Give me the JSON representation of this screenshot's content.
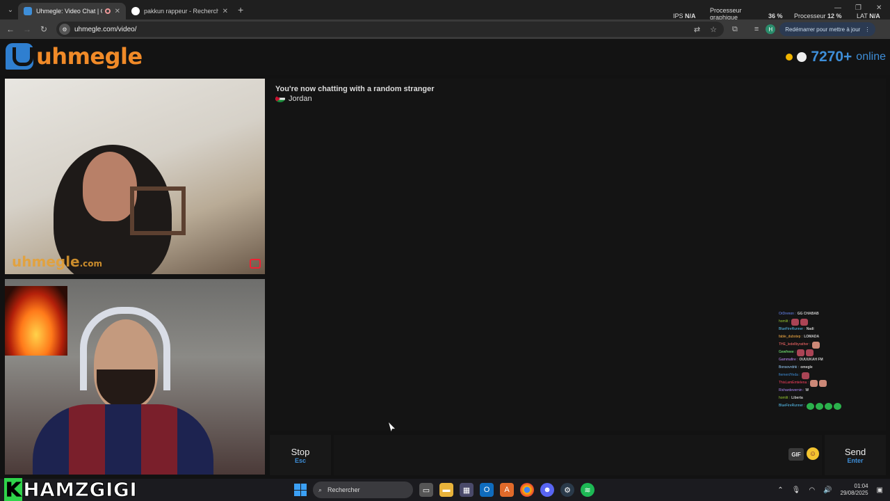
{
  "browser": {
    "tabs": [
      {
        "title": "Uhmegle: Video Chat | Om",
        "active": true,
        "favicon_color": "#3e8ed8"
      },
      {
        "title": "pakkun rappeur - Recherche G",
        "active": false,
        "favicon_color": "#ffffff"
      }
    ],
    "url": "uhmegle.com/video/",
    "update_button": "Redémarrer pour mettre à jour",
    "profile_initial": "H"
  },
  "hud": {
    "ips_label": "IPS",
    "ips_value": "N/A",
    "gpu_label_1": "Processeur",
    "gpu_label_2": "graphique",
    "gpu_value": "36 %",
    "cpu_label": "Processeur",
    "cpu_value": "12 %",
    "lat_label": "LAT",
    "lat_value": "N/A"
  },
  "site": {
    "logo_text": "uhmegle",
    "online_count": "7270+",
    "online_label": "online",
    "accent": "#3e8ed8",
    "brand_orange": "#f08a28"
  },
  "video": {
    "watermark": "uhmegle",
    "watermark_suffix": ".com"
  },
  "chat": {
    "status": "You're now chatting with a random stranger",
    "stranger_name": "Jordan",
    "stranger_flag": "jordan-flag"
  },
  "stream_chat": [
    {
      "user": "OrDrenon",
      "msg": "GG CHABAB",
      "color": "#6b8cff",
      "emotes": 0
    },
    {
      "user": "homlit",
      "msg": "",
      "color": "#9acd32",
      "emotes": 2
    },
    {
      "user": "BlueFireRunner",
      "msg": "Nadi",
      "color": "#5ac8fa",
      "emotes": 0
    },
    {
      "user": "fable_dubstep",
      "msg": "LOMADA",
      "color": "#ffb347",
      "emotes": 0
    },
    {
      "user": "THE_ledellbyrather",
      "msg": "",
      "color": "#ff6a6a",
      "emotes": 1
    },
    {
      "user": "Gewfreee",
      "msg": "",
      "color": "#7fff7f",
      "emotes": 2
    },
    {
      "user": "Gammafire",
      "msg": "OUUUKAH FM",
      "color": "#c38cff",
      "emotes": 0
    },
    {
      "user": "Bonsovrdrki",
      "msg": "omegle",
      "color": "#9ad0ff",
      "emotes": 0
    },
    {
      "user": "fiemerdYeda",
      "msg": "",
      "color": "#3e8ed8",
      "emotes": 1
    },
    {
      "user": "ThisLamEmtelena",
      "msg": "",
      "color": "#ff4060",
      "emotes": 2
    },
    {
      "user": "Richardevernin",
      "msg": "W",
      "color": "#b18cff",
      "emotes": 0
    },
    {
      "user": "homlit",
      "msg": "Liberta",
      "color": "#9acd32",
      "emotes": 0
    },
    {
      "user": "BlueFireRunner",
      "msg": "",
      "color": "#5ac8fa",
      "emotes": 4
    }
  ],
  "controls": {
    "stop_label": "Stop",
    "stop_key": "Esc",
    "send_label": "Send",
    "send_key": "Enter",
    "gif_label": "GIF",
    "message_placeholder": ""
  },
  "overlay": {
    "streamer_name_first": "K",
    "streamer_name_rest": "HAMZGIGI"
  },
  "taskbar": {
    "search_placeholder": "Rechercher",
    "time": "01:04",
    "date": "29/08/2025"
  }
}
